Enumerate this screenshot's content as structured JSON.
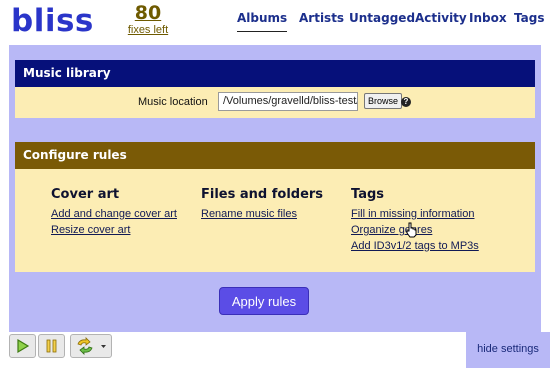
{
  "app": {
    "logo": "bliss"
  },
  "fixes": {
    "count": "80",
    "label": "fixes left"
  },
  "nav": {
    "tabs": [
      {
        "label": "Albums",
        "active": true
      },
      {
        "label": "Artists",
        "active": false
      },
      {
        "label": "Untagged",
        "active": false
      },
      {
        "label": "Activity",
        "active": false
      },
      {
        "label": "Inbox",
        "active": false
      },
      {
        "label": "Tags",
        "active": false
      }
    ]
  },
  "music_library": {
    "title": "Music library",
    "location_label": "Music location",
    "location_value": "/Volumes/gravelld/bliss-test/t",
    "browse_label": "Browse",
    "help_icon": "?"
  },
  "configure_rules": {
    "title": "Configure rules",
    "columns": [
      {
        "title": "Cover art",
        "links": [
          "Add and change cover art",
          "Resize cover art"
        ]
      },
      {
        "title": "Files and folders",
        "links": [
          "Rename music files"
        ]
      },
      {
        "title": "Tags",
        "links": [
          "Fill in missing information",
          "Organize genres",
          "Add ID3v1/2 tags to MP3s"
        ]
      }
    ],
    "apply_label": "Apply rules"
  },
  "toolbar": {
    "icons": [
      "play-icon",
      "pause-icon",
      "sync-icon",
      "dropdown-arrow-icon"
    ]
  },
  "footer": {
    "hide_settings": "hide settings"
  },
  "colors": {
    "brand": "#2a35c9",
    "panel": "#b8b8f6",
    "music_header": "#06107a",
    "rules_header": "#7a5a06",
    "section_body": "#fcedb4",
    "apply_button": "#5b4de6"
  }
}
